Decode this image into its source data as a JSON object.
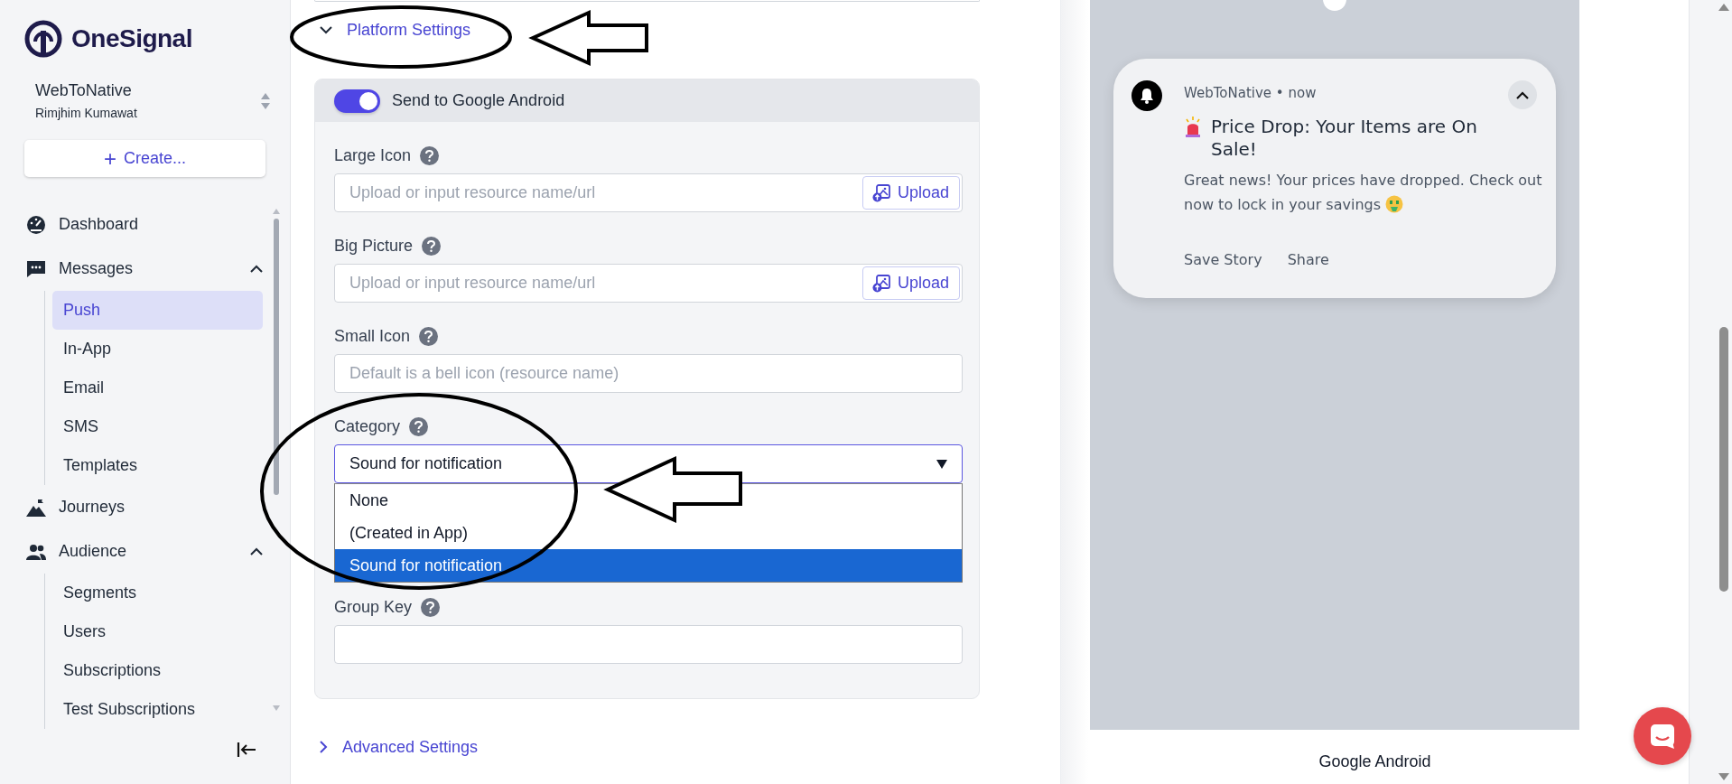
{
  "brand": {
    "name": "OneSignal"
  },
  "app_switcher": {
    "app": "WebToNative",
    "user": "Rimjhim Kumawat"
  },
  "create_button": {
    "icon": "+",
    "label": "Create..."
  },
  "nav": [
    {
      "label": "Dashboard"
    },
    {
      "label": "Messages",
      "expanded": true,
      "children": [
        {
          "label": "Push",
          "selected": true
        },
        {
          "label": "In-App",
          "selected": false
        },
        {
          "label": "Email",
          "selected": false
        },
        {
          "label": "SMS",
          "selected": false
        },
        {
          "label": "Templates",
          "selected": false
        }
      ]
    },
    {
      "label": "Journeys"
    },
    {
      "label": "Audience",
      "expanded": true,
      "children": [
        {
          "label": "Segments",
          "selected": false
        },
        {
          "label": "Users",
          "selected": false
        },
        {
          "label": "Subscriptions",
          "selected": false
        },
        {
          "label": "Test Subscriptions",
          "selected": false
        }
      ]
    }
  ],
  "platform_section": {
    "title": "Platform Settings",
    "expanded": true
  },
  "platform": {
    "label": "Send to Google Android",
    "on": true
  },
  "fields": [
    {
      "kind": "upload",
      "label": "Large Icon",
      "placeholder": "Upload or input resource name/url",
      "button": "Upload"
    },
    {
      "kind": "upload",
      "label": "Big Picture",
      "placeholder": "Upload or input resource name/url",
      "button": "Upload"
    },
    {
      "kind": "text",
      "label": "Small Icon",
      "placeholder": "Default is a bell icon (resource name)"
    },
    {
      "kind": "select",
      "label": "Category",
      "value": "Sound for notification",
      "expanded": true,
      "options": [
        {
          "label": "None",
          "selected": false
        },
        {
          "label": "(Created in App)",
          "selected": false
        },
        {
          "label": "Sound for notification",
          "selected": true
        }
      ]
    },
    {
      "kind": "text",
      "label": "Group Key"
    }
  ],
  "advanced_section": {
    "title": "Advanced Settings",
    "expanded": false
  },
  "preview": {
    "app": "WebToNative • now",
    "expanded": true,
    "title": "Price Drop: Your Items are On Sale!",
    "body": "Great news! Your prices have dropped. Check out now to lock in your savings",
    "actions": [
      "Save Story",
      "Share"
    ],
    "platform": "Google Android"
  }
}
